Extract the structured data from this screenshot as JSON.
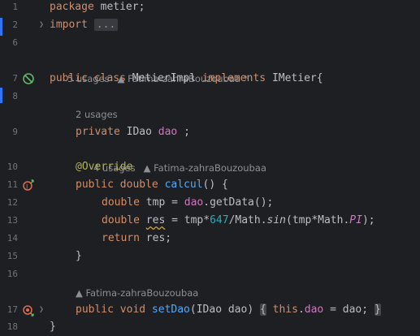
{
  "lines": {
    "l1": {
      "num": "1",
      "t1": "package",
      "t2": " metier;"
    },
    "l2": {
      "num": "2",
      "t1": "import",
      "t2": "..."
    },
    "l6": {
      "num": "6"
    },
    "h7": {
      "usages": "5 usages",
      "author": "Fatima-zahraBouzoubaa *"
    },
    "l7": {
      "num": "7",
      "t1": "public class",
      "t2": " MetierImpl ",
      "t3": "implements",
      "t4": " IMetier{"
    },
    "l8": {
      "num": "8"
    },
    "h9": {
      "usages": "2 usages"
    },
    "l9": {
      "num": "9",
      "t1": "private",
      "t2": " IDao ",
      "t3": "dao",
      "t4": " ;"
    },
    "h10": {
      "usages": "4 usages",
      "author": "Fatima-zahraBouzoubaa"
    },
    "l10": {
      "num": "10",
      "t1": "@Override"
    },
    "l11": {
      "num": "11",
      "t1": "public double",
      "t2": " ",
      "t3": "calcul",
      "t4": "() {"
    },
    "l12": {
      "num": "12",
      "t1": "double",
      "t2": " tmp = ",
      "t3": "dao",
      "t4": ".getData();"
    },
    "l13": {
      "num": "13",
      "t1": "double",
      "t2": " ",
      "t3": "res",
      "t4": " = tmp*",
      "t5": "647",
      "t6": "/Math.",
      "t7": "sin",
      "t8": "(tmp*Math.",
      "t9": "PI",
      "t10": ");"
    },
    "l14": {
      "num": "14",
      "t1": "return",
      "t2": " res;"
    },
    "l15": {
      "num": "15",
      "t1": "}"
    },
    "l16": {
      "num": "16"
    },
    "h17": {
      "author": "Fatima-zahraBouzoubaa"
    },
    "l17": {
      "num": "17",
      "t1": "public void",
      "t2": " ",
      "t3": "setDao",
      "t4": "(IDao dao) ",
      "t5": "{",
      "t6": " ",
      "t7": "this",
      "t8": ".",
      "t9": "dao",
      "t10": " = dao; ",
      "t11": "}"
    },
    "l18": {
      "num": "18",
      "t1": "}"
    }
  },
  "gutter_icons": {
    "l7": "implemented-interface-icon",
    "l11": "override-method-icon",
    "l17": "setter-bean-icon"
  },
  "colors": {
    "background": "#1e1f22",
    "keyword": "#cf8e6d",
    "field": "#c77dbb",
    "function": "#56a8f5",
    "number": "#2aacb8",
    "annotation": "#b3ae60",
    "vcs_marker": "#3574f0"
  }
}
